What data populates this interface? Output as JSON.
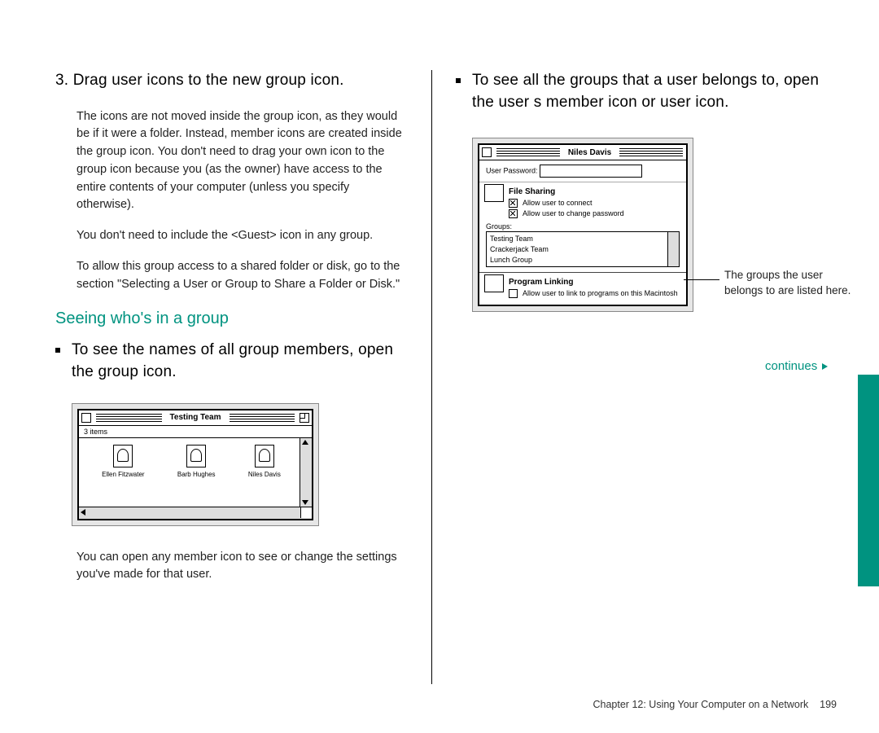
{
  "left": {
    "step_number": "3.",
    "step_title": "Drag user icons to the new group icon.",
    "p1": "The icons are not moved inside the group icon, as they would be if it were a folder. Instead, member icons are created inside the group icon. You don't need to drag your own icon to the group icon because you (as the owner) have access to the entire contents of your computer (unless you specify otherwise).",
    "p2": "You don't need to include the <Guest> icon in any group.",
    "p3": "To allow this group access to a shared folder or disk, go to the section \"Selecting a User or Group to Share a Folder or Disk.\"",
    "section_head": "Seeing who's in a group",
    "bullet1": "To see the names of all group members, open the group icon.",
    "p4": "You can open any member icon to see or change the settings you've made for that user."
  },
  "testing_window": {
    "title": "Testing Team",
    "items_count": "3 items",
    "members": [
      "Ellen Fitzwater",
      "Barb Hughes",
      "Niles Davis"
    ]
  },
  "right": {
    "bullet1": "To see all the groups that a user belongs to, open the user s member icon or user icon.",
    "callout": "The groups the user belongs to are listed here.",
    "continues": "continues"
  },
  "niles_window": {
    "title": "Niles Davis",
    "password_label": "User Password:",
    "section_file_sharing": "File Sharing",
    "check1": "Allow user to connect",
    "check2": "Allow user to change password",
    "groups_label": "Groups:",
    "groups": [
      "Testing Team",
      "Crackerjack Team",
      "Lunch Group"
    ],
    "section_program_linking": "Program Linking",
    "check3": "Allow user to link to programs on this Macintosh"
  },
  "footer": {
    "chapter": "Chapter 12: Using Your Computer on a Network",
    "page": "199"
  }
}
